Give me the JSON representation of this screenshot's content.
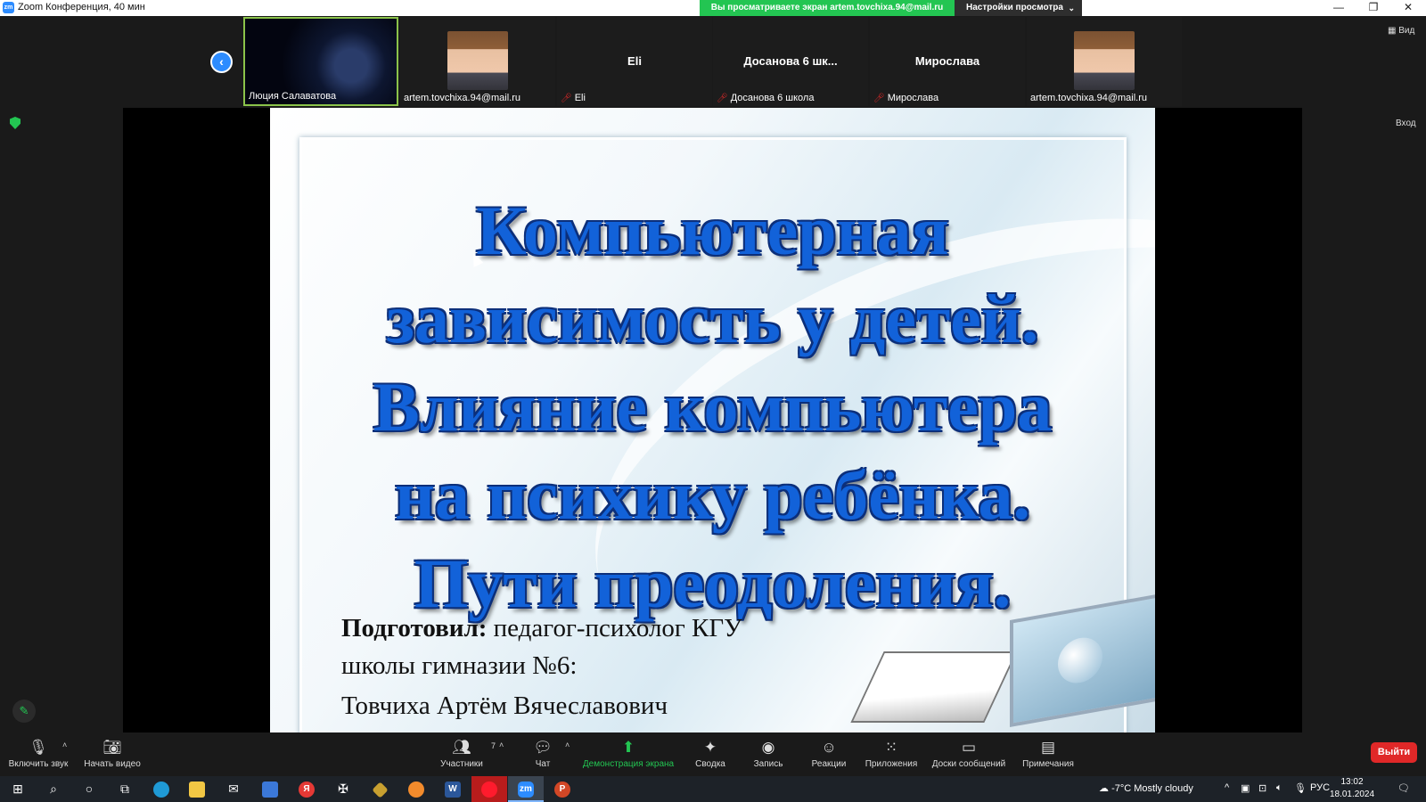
{
  "window": {
    "title": "Zoom Конференция, 40 мин",
    "app_icon": "zm",
    "share_banner": "Вы просматриваете экран artem.tovchixa.94@mail.ru",
    "view_settings": "Настройки просмотра",
    "minimize": "—",
    "restore": "❐",
    "close": "✕"
  },
  "strip": {
    "prev": "‹",
    "view_label": "Вид",
    "login_label": "Вход",
    "participants": [
      {
        "label": "Люция Салаватова",
        "muted": false,
        "center_name": ""
      },
      {
        "label": "artem.tovchixa.94@mail.ru",
        "muted": false,
        "center_name": ""
      },
      {
        "label": "Eli",
        "muted": true,
        "center_name": "Eli"
      },
      {
        "label": "Досанова 6 школа",
        "muted": true,
        "center_name": "Досанова 6 шк..."
      },
      {
        "label": "Мирослава",
        "muted": true,
        "center_name": "Мирослава"
      },
      {
        "label": "artem.tovchixa.94@mail.ru",
        "muted": false,
        "center_name": ""
      }
    ]
  },
  "slide": {
    "title_lines": [
      "Компьютерная",
      "зависимость у детей.",
      "Влияние компьютера",
      "на психику ребёнка.",
      "Пути преодоления."
    ],
    "author_bold": "Подготовил:",
    "author_rest": " педагог-психолог КГУ",
    "author_line2": "школы гимназии №6:",
    "author_line3": "Товчиха Артём Вячеславович"
  },
  "toolbar": {
    "unmute": "Включить звук",
    "start_video": "Начать видео",
    "participants": "Участники",
    "participants_count": "7",
    "chat": "Чат",
    "share_screen": "Демонстрация экрана",
    "summary": "Сводка",
    "record": "Запись",
    "reactions": "Реакции",
    "apps": "Приложения",
    "whiteboards": "Доски сообщений",
    "notes": "Примечания",
    "leave": "Выйти",
    "caret": "˄"
  },
  "taskbar": {
    "weather_temp": "-7°C",
    "weather_desc": "Mostly cloudy",
    "language": "РУС",
    "time": "13:02",
    "date": "18.01.2024",
    "yandex_label": "Я",
    "word_label": "W",
    "zoom_label": "zm",
    "ppt_label": "P"
  },
  "colors": {
    "accent_green": "#23c552",
    "zoom_blue": "#2d8cff",
    "leave_red": "#e02828",
    "slide_title_blue": "#1262d9"
  }
}
